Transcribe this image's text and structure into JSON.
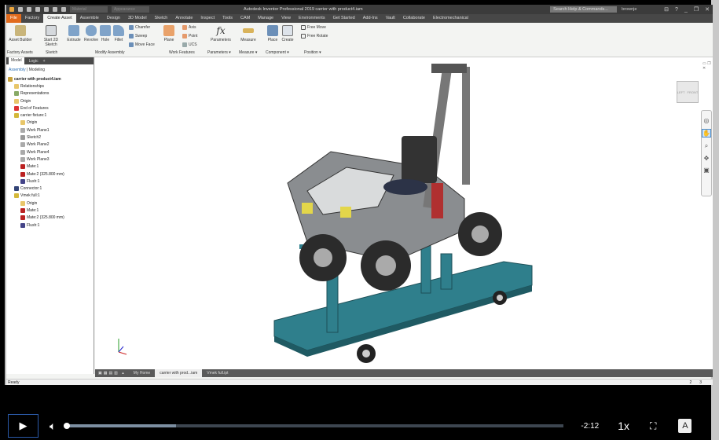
{
  "titlebar": {
    "material": "Material",
    "appearance": "Appearance",
    "title": "Autodesk Inventor Professional 2019   carrier with product4.iam",
    "search_placeholder": "Search Help & Commands...",
    "user": "brownje"
  },
  "tabs": [
    "File",
    "Factory",
    "Create Asset",
    "Assemble",
    "Design",
    "3D Model",
    "Sketch",
    "Annotate",
    "Inspect",
    "Tools",
    "CAM",
    "Manage",
    "View",
    "Environments",
    "Get Started",
    "Add-Ins",
    "Vault",
    "Collaborate",
    "Electromechanical"
  ],
  "active_tab": "Create Asset",
  "ribbon": {
    "buttons": {
      "asset_builder": "Asset Builder",
      "start_sketch": "Start 2D Sketch",
      "extrude": "Extrude",
      "revolve": "Revolve",
      "hole": "Hole",
      "fillet": "Fillet",
      "chamfer": "Chamfer",
      "sweep": "Sweep",
      "move_face": "Move Face",
      "plane": "Plane",
      "axis": "Axis",
      "point": "Point",
      "ucs": "UCS",
      "parameters": "Parameters",
      "measure": "Measure",
      "place": "Place",
      "create": "Create",
      "free_move": "Free Move",
      "free_rotate": "Free Rotate"
    },
    "panels": {
      "factory_assets": "Factory Assets",
      "sketch": "Sketch",
      "modify_assembly": "Modify Assembly",
      "work_features": "Work Features",
      "parameters": "Parameters ▾",
      "measure": "Measure ▾",
      "component": "Component ▾",
      "position": "Position ▾"
    }
  },
  "browser": {
    "tab_model": "Model",
    "tab_logic": "Logic",
    "mode_assembly": "Assembly",
    "mode_modeling": "Modeling",
    "tree": [
      {
        "label": "carrier with product4.iam",
        "level": 0,
        "icon": "assembly-icon"
      },
      {
        "label": "Relationships",
        "level": 1,
        "icon": "folder-icon"
      },
      {
        "label": "Representations",
        "level": 1,
        "icon": "representations-icon"
      },
      {
        "label": "Origin",
        "level": 1,
        "icon": "folder-icon"
      },
      {
        "label": "End of Features",
        "level": 1,
        "icon": "end-of-features-icon"
      },
      {
        "label": "carrier fixture:1",
        "level": 1,
        "icon": "part-icon"
      },
      {
        "label": "Origin",
        "level": 2,
        "icon": "folder-icon"
      },
      {
        "label": "Work Plane1",
        "level": 2,
        "icon": "work-plane-icon"
      },
      {
        "label": "Sketch2",
        "level": 2,
        "icon": "sketch-icon"
      },
      {
        "label": "Work Plane2",
        "level": 2,
        "icon": "work-plane-icon"
      },
      {
        "label": "Work Plane4",
        "level": 2,
        "icon": "work-plane-icon"
      },
      {
        "label": "Work Plane3",
        "level": 2,
        "icon": "work-plane-icon"
      },
      {
        "label": "Mate:1",
        "level": 2,
        "icon": "mate-icon"
      },
      {
        "label": "Mate:2 (325.800 mm)",
        "level": 2,
        "icon": "mate-icon"
      },
      {
        "label": "Flush:1",
        "level": 2,
        "icon": "flush-icon"
      },
      {
        "label": "Connector:1",
        "level": 1,
        "icon": "connector-icon"
      },
      {
        "label": "Vmek full:1",
        "level": 1,
        "icon": "part-icon"
      },
      {
        "label": "Origin",
        "level": 2,
        "icon": "folder-icon"
      },
      {
        "label": "Mate:1",
        "level": 2,
        "icon": "mate-icon"
      },
      {
        "label": "Mate:2 (325.800 mm)",
        "level": 2,
        "icon": "mate-icon"
      },
      {
        "label": "Flush:1",
        "level": 2,
        "icon": "flush-icon"
      }
    ]
  },
  "viewcube": {
    "left": "LEFT",
    "front": "FRONT"
  },
  "doc_tabs": [
    "My Home",
    "carrier with prod...iam",
    "Vmek full.ipt"
  ],
  "active_doc": "carrier with prod...iam",
  "status": {
    "text": "Ready",
    "count1": "2",
    "count2": "3"
  },
  "player": {
    "time_remaining": "-2:12",
    "speed": "1x",
    "captions": "A",
    "progress_played": 0,
    "progress_buffered": 22
  },
  "colors": {
    "file_tab": "#e16b1d",
    "platform": "#2f7f8c",
    "accent": "#2b6fb5"
  }
}
